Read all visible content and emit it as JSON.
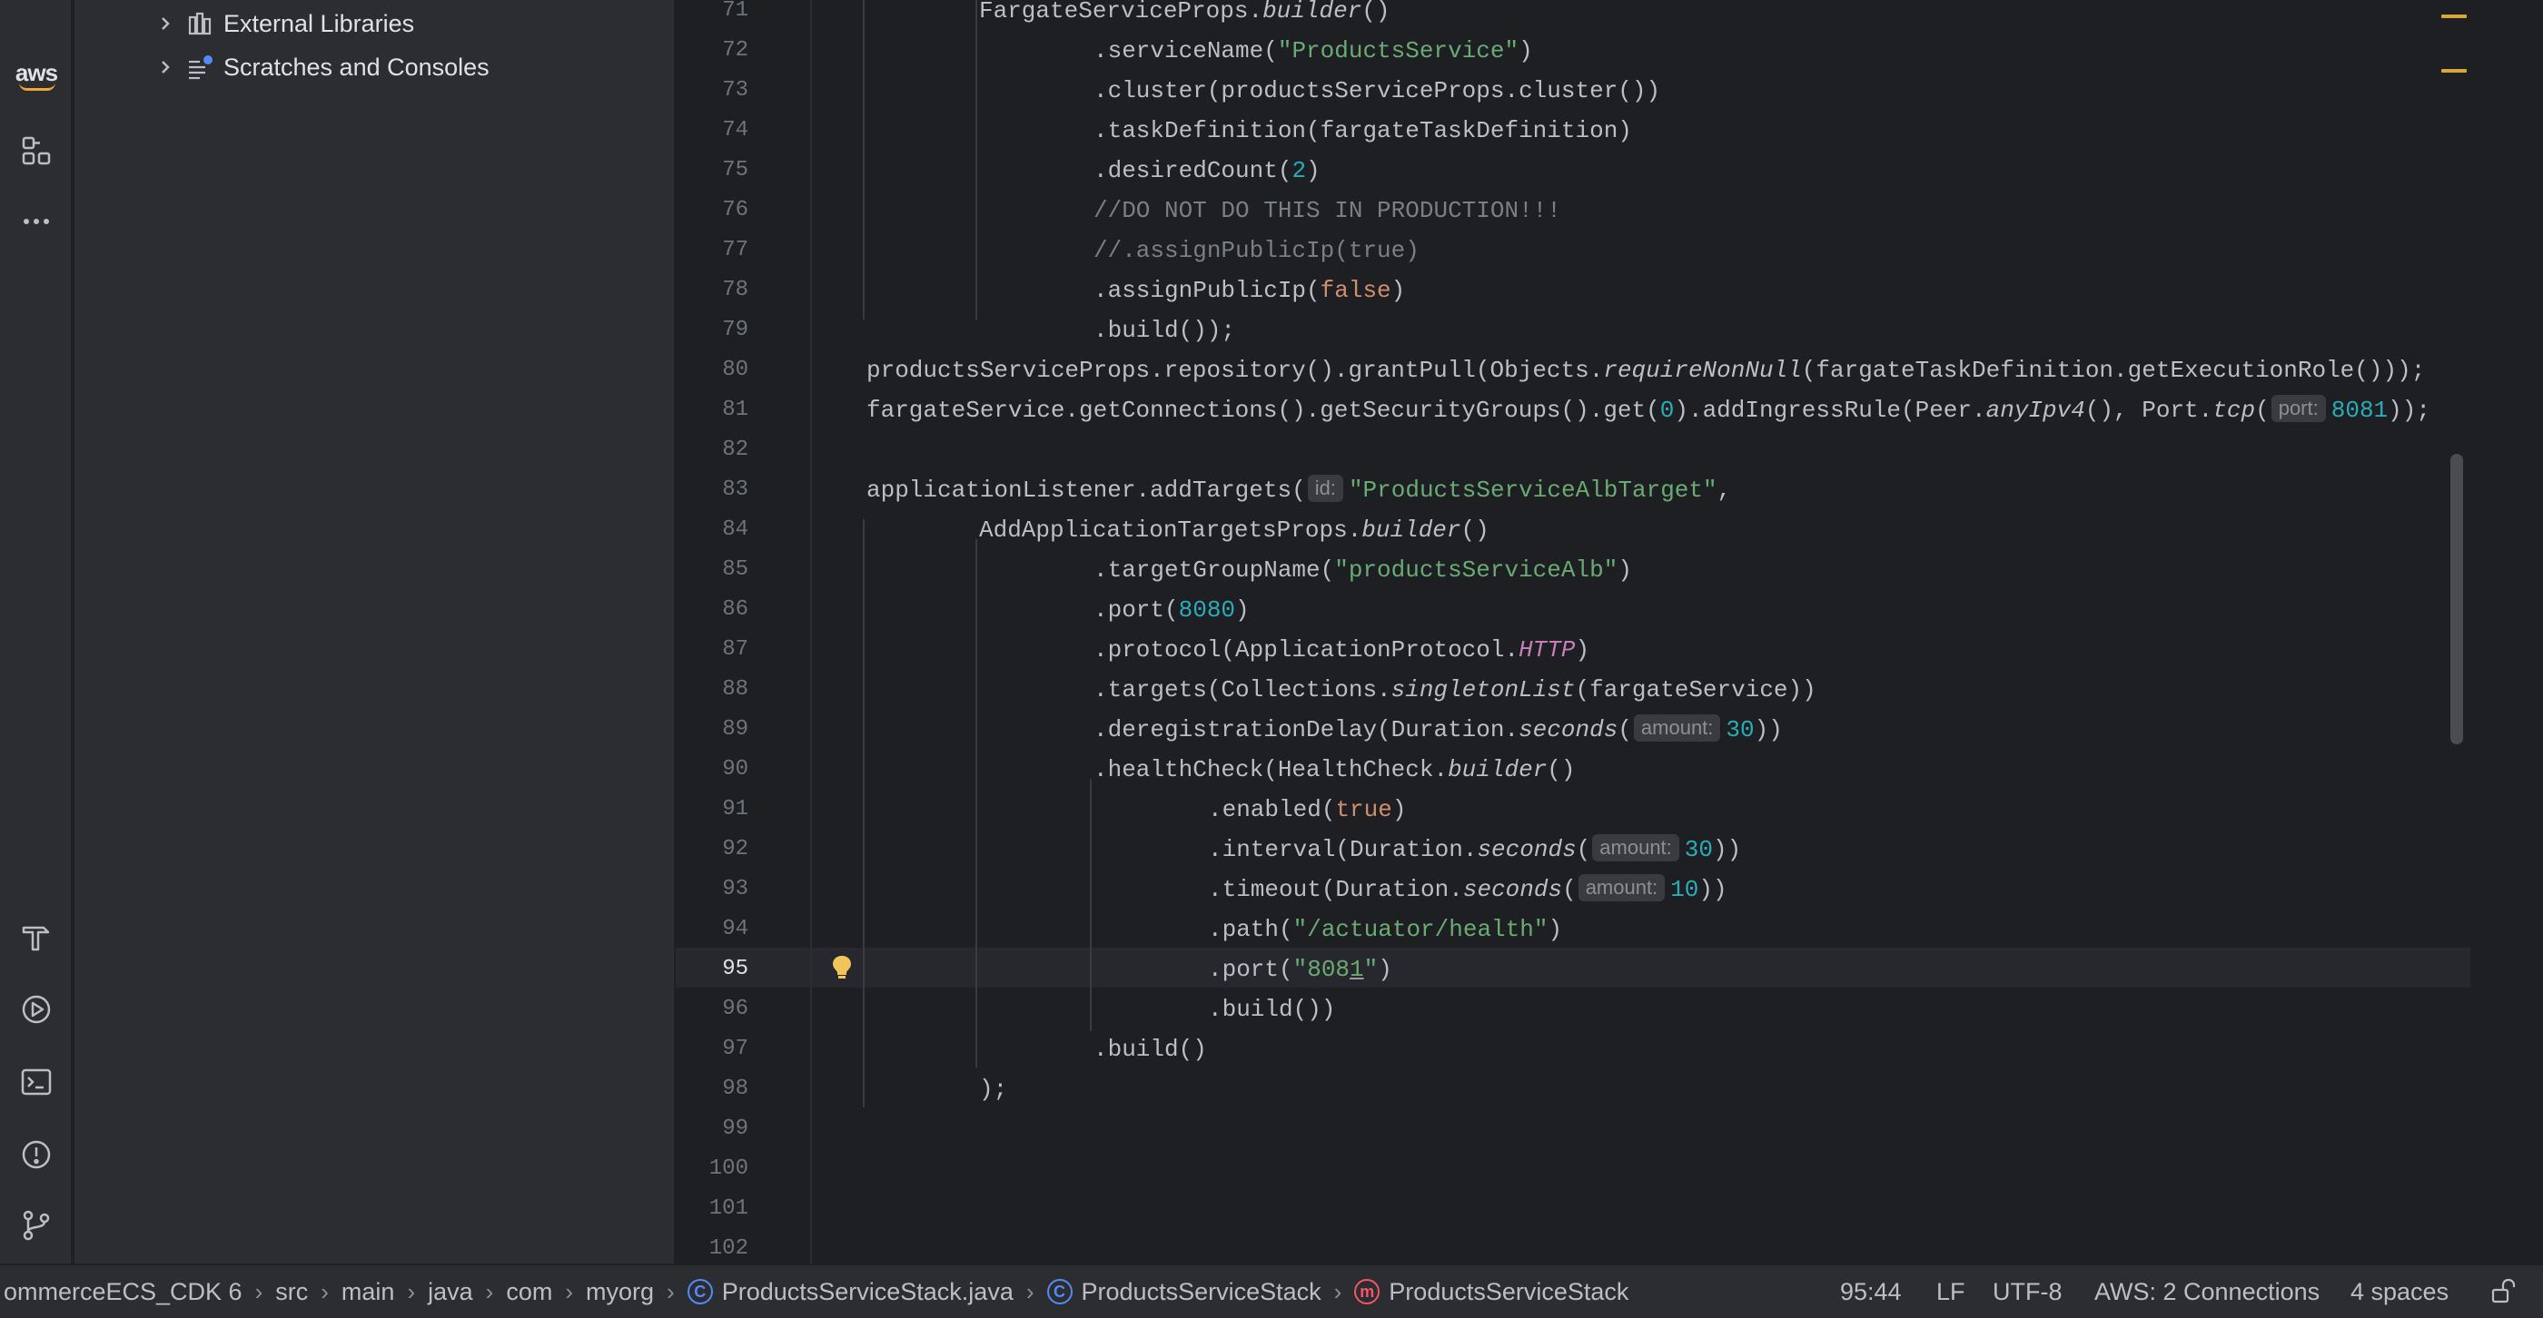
{
  "project_tree": {
    "items": [
      {
        "label": "External Libraries",
        "icon": "library-icon"
      },
      {
        "label": "Scratches and Consoles",
        "icon": "scratches-icon"
      }
    ]
  },
  "tool_strip": {
    "aws_label": "aws",
    "icons": [
      "aws-toolkit-icon",
      "structure-icon",
      "more-icon",
      "build-icon",
      "run-icon",
      "terminal-icon",
      "problems-icon",
      "git-icon"
    ]
  },
  "editor": {
    "line_numbers": [
      "71",
      "72",
      "73",
      "74",
      "75",
      "76",
      "77",
      "78",
      "79",
      "80",
      "81",
      "82",
      "83",
      "84",
      "85",
      "86",
      "87",
      "88",
      "89",
      "90",
      "91",
      "92",
      "93",
      "94",
      "95",
      "96",
      "97",
      "98",
      "99",
      "100",
      "101",
      "102"
    ],
    "current_line": "95",
    "inlay_hints": {
      "port": "port:",
      "id": "id:",
      "amount": "amount:"
    }
  },
  "status_bar": {
    "breadcrumbs": [
      {
        "label": "ommerceECS_CDK 6",
        "kind": "project"
      },
      {
        "label": "src",
        "kind": "folder"
      },
      {
        "label": "main",
        "kind": "folder"
      },
      {
        "label": "java",
        "kind": "folder"
      },
      {
        "label": "com",
        "kind": "folder"
      },
      {
        "label": "myorg",
        "kind": "folder"
      },
      {
        "label": "ProductsServiceStack.java",
        "kind": "class-file"
      },
      {
        "label": "ProductsServiceStack",
        "kind": "class"
      },
      {
        "label": "ProductsServiceStack",
        "kind": "method"
      }
    ],
    "class_icon_letter": "C",
    "method_icon_letter": "m",
    "position": "95:44",
    "line_separator": "LF",
    "encoding": "UTF-8",
    "aws_connections": "AWS: 2 Connections",
    "indent": "4 spaces"
  },
  "colors": {
    "background": "#1e1f22",
    "panel": "#2b2d30",
    "string": "#6aab73",
    "number": "#2aacb8",
    "keyword": "#cf8e6d",
    "comment": "#7a7e85",
    "constant": "#c77dbb",
    "accent_aws": "#f2a33a"
  }
}
